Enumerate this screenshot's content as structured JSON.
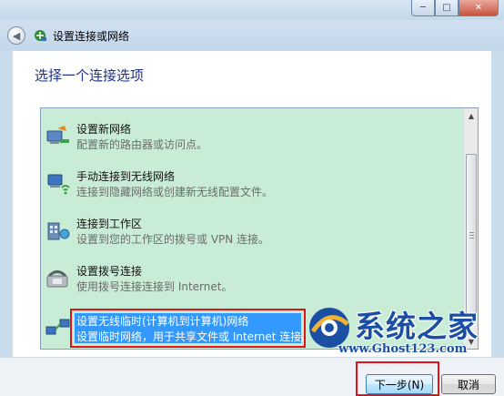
{
  "window": {
    "controls": {
      "minimize": "─",
      "maximize": "□",
      "close": "✕"
    }
  },
  "nav": {
    "back_icon": "back-arrow-icon",
    "title": "设置连接或网络"
  },
  "main": {
    "heading": "选择一个连接选项",
    "options": [
      {
        "title": "设置新网络",
        "desc": "配置新的路由器或访问点。",
        "icon": "new-network-icon"
      },
      {
        "title": "手动连接到无线网络",
        "desc": "连接到隐藏网络或创建新无线配置文件。",
        "icon": "wireless-network-icon"
      },
      {
        "title": "连接到工作区",
        "desc": "设置到您的工作区的拨号或 VPN 连接。",
        "icon": "workplace-icon"
      },
      {
        "title": "设置拨号连接",
        "desc": "使用拨号连接连接到 Internet。",
        "icon": "dialup-phone-icon"
      },
      {
        "title": "设置无线临时(计算机到计算机)网络",
        "desc": "设置临时网络，用于共享文件或 Internet 连接。",
        "icon": "adhoc-network-icon",
        "selected": true
      }
    ]
  },
  "buttons": {
    "next": "下一步(N)",
    "cancel": "取消"
  },
  "watermark": {
    "brand": "系统之家",
    "url": "www.Ghost123.com"
  },
  "colors": {
    "highlight": "#e0151b",
    "selection": "#3399ff",
    "list_bg": "#c8ecd6",
    "heading": "#1e3287"
  }
}
